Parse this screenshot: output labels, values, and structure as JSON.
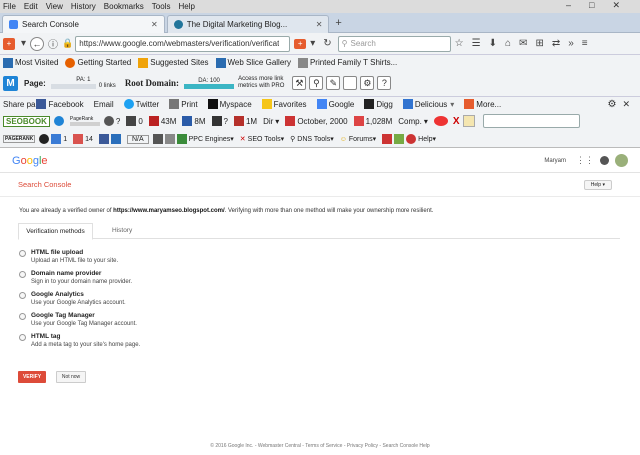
{
  "browser": {
    "menu": [
      "File",
      "Edit",
      "View",
      "History",
      "Bookmarks",
      "Tools",
      "Help"
    ],
    "tabs": [
      {
        "title": "Search Console",
        "active": true,
        "favicon_color": "#4285f4"
      },
      {
        "title": "The Digital Marketing Blog...",
        "active": false,
        "favicon_color": "#21759b"
      }
    ],
    "new_tab": "+",
    "url": "https://www.google.com/webmasters/verification/verificat",
    "search_placeholder": "Search",
    "bookmarks": [
      {
        "label": "Most Visited",
        "color": "#2b6cb0"
      },
      {
        "label": "Getting Started",
        "color": "#e66000"
      },
      {
        "label": "Suggested Sites",
        "color": "#f0a30a"
      },
      {
        "label": "Web Slice Gallery",
        "color": "#2b6cb0"
      },
      {
        "label": "Printed Family T Shirts...",
        "color": "#666"
      }
    ],
    "seo_toolbar": {
      "page_label": "Page:",
      "pa": "PA: 1",
      "links": "0 links",
      "root_label": "Root Domain:",
      "da": "DA: 100",
      "pro_text_1": "Access more link",
      "pro_text_2": "metrics with PRO"
    },
    "share": {
      "label": "Share pa",
      "items": [
        "Facebook",
        "Email",
        "Twitter",
        "Print",
        "Myspace",
        "Favorites",
        "Google",
        "Digg",
        "Delicious",
        "More..."
      ]
    },
    "seo_bar2": {
      "brand": "SEOBOOK",
      "pagerank_label": "PageRank",
      "q1": "?",
      "n0": "0",
      "v43m": "43M",
      "v8m": "8M",
      "q2": "?",
      "v1m": "1M",
      "dir": "Dir",
      "date": "October, 2000",
      "v1028": "1,028M",
      "comp": "Comp.",
      "x": "X"
    },
    "seo_bar3": {
      "label": "PAGERANK",
      "n1": "1",
      "n14": "14",
      "na": "N/A",
      "ppc": "PPC Engines",
      "seo": "SEO Tools",
      "dns": "DNS Tools",
      "forums": "Forums",
      "help": "Help"
    }
  },
  "google": {
    "logo_letters": [
      {
        "c": "G",
        "color": "#4285f4"
      },
      {
        "c": "o",
        "color": "#ea4335"
      },
      {
        "c": "o",
        "color": "#fbbc05"
      },
      {
        "c": "g",
        "color": "#4285f4"
      },
      {
        "c": "l",
        "color": "#34a853"
      },
      {
        "c": "e",
        "color": "#ea4335"
      }
    ],
    "user": "Maryam",
    "title": "Search Console",
    "help": "Help",
    "owner_msg_pre": "You are already a verified owner of ",
    "owner_msg_url": "https://www.maryamseo.blogspot.com/",
    "owner_msg_post": ". Verifying with more than one method will make your ownership more resilient.",
    "tabs": [
      "Verification methods",
      "History"
    ],
    "methods": [
      {
        "title": "HTML file upload",
        "desc": "Upload an HTML file to your site."
      },
      {
        "title": "Domain name provider",
        "desc": "Sign in to your domain name provider."
      },
      {
        "title": "Google Analytics",
        "desc": "Use your Google Analytics account."
      },
      {
        "title": "Google Tag Manager",
        "desc": "Use your Google Tag Manager account."
      },
      {
        "title": "HTML tag",
        "desc": "Add a meta tag to your site's home page."
      }
    ],
    "verify": "VERIFY",
    "not_now": "Not now",
    "footer": "© 2016 Google Inc. - Webmaster Central - Terms of Service - Privacy Policy - Search Console Help",
    "accent": "#dd4b39"
  }
}
